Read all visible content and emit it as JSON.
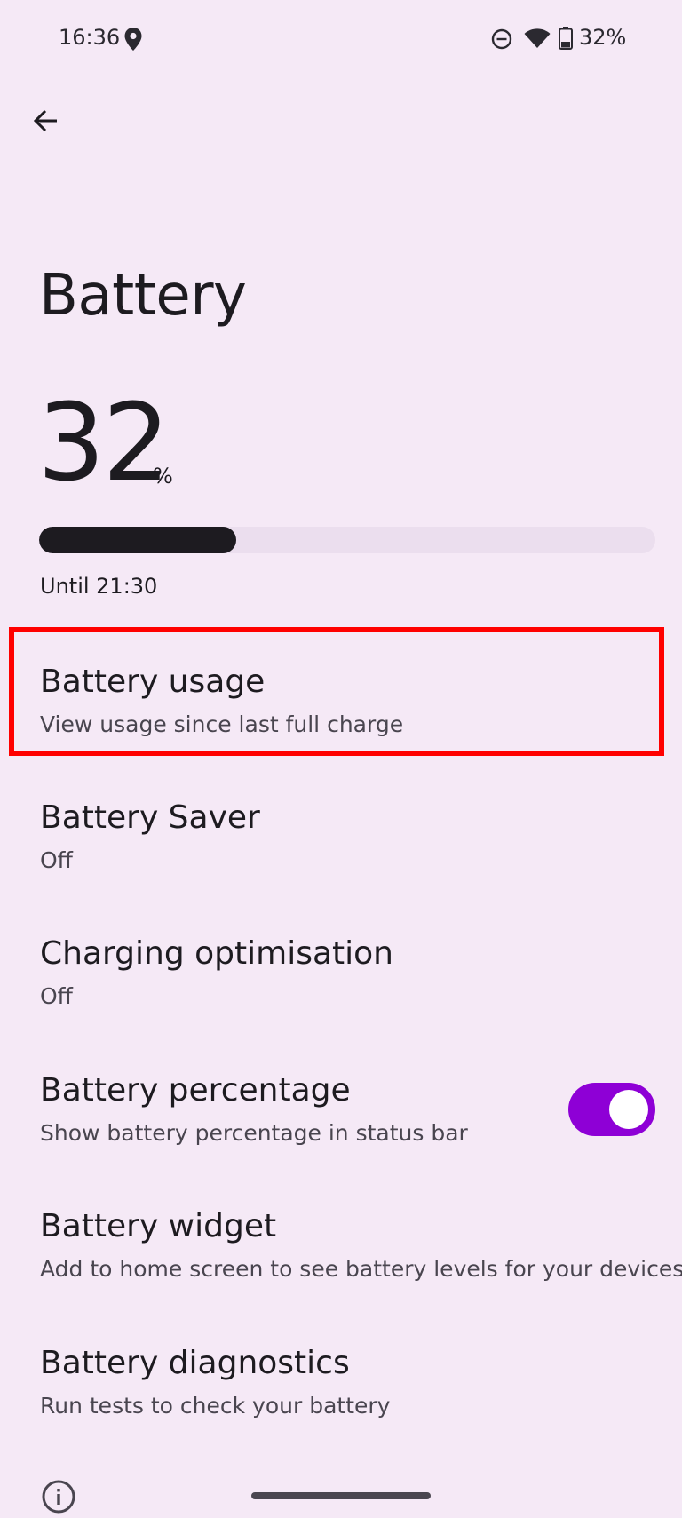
{
  "status_bar": {
    "time": "16:36",
    "battery_percent": "32%",
    "icons": [
      "location-icon",
      "do-not-disturb-icon",
      "wifi-icon",
      "battery-icon"
    ]
  },
  "header": {
    "back_icon": "arrow-back-icon",
    "title": "Battery"
  },
  "battery_level": {
    "value": "32",
    "unit": "%",
    "fraction": 0.32,
    "estimate": "Until 21:30"
  },
  "preferences": [
    {
      "title": "Battery usage",
      "summary": "View usage since last full charge"
    },
    {
      "title": "Battery Saver",
      "summary": "Off"
    },
    {
      "title": "Charging optimisation",
      "summary": "Off"
    },
    {
      "title": "Battery percentage",
      "summary": "Show battery percentage in status bar",
      "toggle_on": true
    },
    {
      "title": "Battery widget",
      "summary": "Add to home screen to see battery levels for your devices"
    },
    {
      "title": "Battery diagnostics",
      "summary": "Run tests to check your battery"
    }
  ],
  "colors": {
    "background": "#f5e9f6",
    "toggle_on": "#8e00d6",
    "highlight": "#ff0000",
    "level_fill": "#1d1b20"
  },
  "footer": {
    "info_icon": "info-icon"
  }
}
